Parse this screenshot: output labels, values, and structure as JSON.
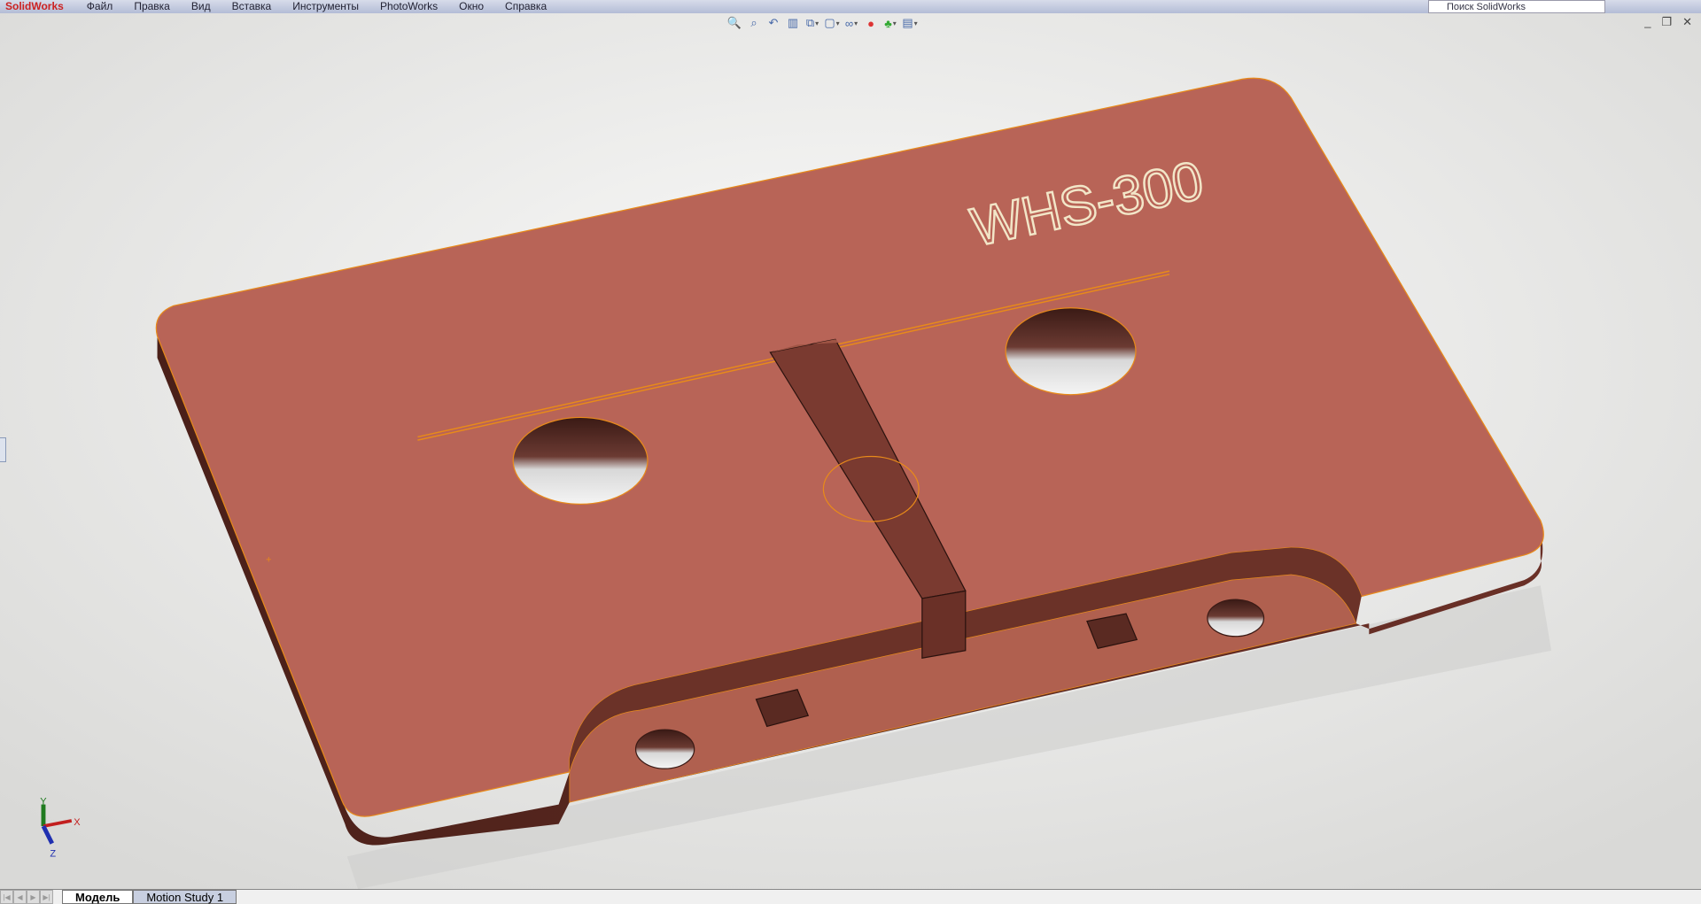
{
  "app": {
    "logo_text": "SolidWorks"
  },
  "menu": [
    "Файл",
    "Правка",
    "Вид",
    "Вставка",
    "Инструменты",
    "PhotoWorks",
    "Окно",
    "Справка"
  ],
  "search": {
    "placeholder": "Поиск SolidWorks"
  },
  "toolbar": [
    "zoom-to-fit-icon",
    "zoom-area-icon",
    "previous-view-icon",
    "section-view-icon",
    "view-orientation-icon",
    "display-style-icon",
    "hide-show-items-icon",
    "edit-appearance-icon",
    "apply-scene-icon",
    "view-settings-icon"
  ],
  "window_controls": {
    "minimize": "_",
    "restore": "❐",
    "close": "✕"
  },
  "model": {
    "engraved_text": "WHS-300",
    "face_color": "#b86457",
    "edge_highlight": "#e88a1a"
  },
  "triad": {
    "x": "X",
    "y": "Y",
    "z": "Z"
  },
  "tabs": [
    {
      "label": "Модель",
      "active": true
    },
    {
      "label": "Motion Study 1",
      "active": false
    }
  ]
}
